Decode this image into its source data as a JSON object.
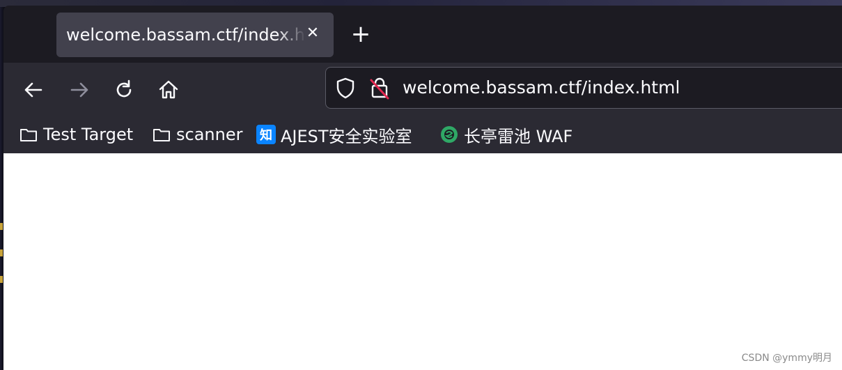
{
  "tab": {
    "title": "welcome.bassam.ctf/index.html",
    "close_icon": "close-icon",
    "new_tab_icon": "plus-icon"
  },
  "nav": {
    "back_icon": "arrow-left-icon",
    "forward_icon": "arrow-right-icon",
    "reload_icon": "reload-icon",
    "home_icon": "home-icon"
  },
  "urlbar": {
    "url": "welcome.bassam.ctf/index.html",
    "shield_icon": "shield-icon",
    "lock_icon": "insecure-lock-icon"
  },
  "bookmarks": [
    {
      "label": "Test Target",
      "icon": "folder-icon"
    },
    {
      "label": "scanner",
      "icon": "folder-icon"
    },
    {
      "label": "AJEST安全实验室",
      "icon": "zhihu-icon",
      "icon_text": "知",
      "color": "#0a84ff"
    },
    {
      "label": "长亭雷池 WAF",
      "icon": "safeline-icon",
      "color": "#2fa866"
    }
  ],
  "watermark": "CSDN @ymmy明月"
}
